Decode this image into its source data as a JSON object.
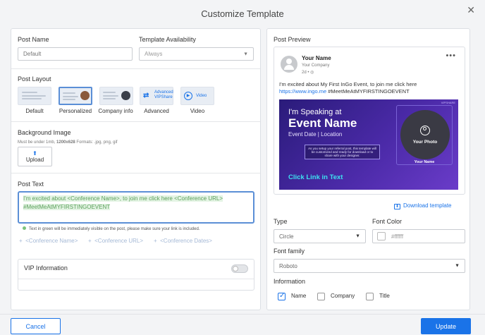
{
  "dialog": {
    "title": "Customize Template"
  },
  "post_name": {
    "label": "Post Name",
    "placeholder": "Default"
  },
  "template_availability": {
    "label": "Template Availability",
    "value": "Always"
  },
  "post_layout": {
    "label": "Post Layout",
    "options": [
      {
        "label": "Default"
      },
      {
        "label": "Personalized"
      },
      {
        "label": "Company info"
      },
      {
        "label": "Advanced",
        "inner": "Advanced VIPShare"
      },
      {
        "label": "Video",
        "inner": "Video"
      }
    ]
  },
  "background_image": {
    "label": "Background Image",
    "hint_prefix": "Must be under 1mb,",
    "hint_size": "1200x628",
    "hint_suffix": "Formats: .jpg, png, gif",
    "upload_label": "Upload"
  },
  "post_text": {
    "label": "Post Text",
    "value": "I'm excited about <Conference Name>, to join me click here <Conference URL> #MeetMeAtMYFIRSTINGOEVENT",
    "hint": "Text in green will be immediately visible on the post, please make sure your link is included.",
    "chips": [
      "<Conference Name>",
      "<Conference URL>",
      "<Conference Dates>"
    ]
  },
  "vip_information": {
    "label": "VIP Information"
  },
  "preview": {
    "label": "Post Preview",
    "name": "Your Name",
    "company": "Your Company",
    "time": "2d •",
    "text_line1": "I'm excited about My First InGo Event, to join me click here",
    "link": "https://www.ingo.me",
    "hashtag": "#MeetMeAtMYFIRSTINGOEVENT",
    "banner": {
      "speaking": "I'm Speaking at",
      "event_name": "Event Name",
      "event_meta": "Event Date | Location",
      "description": "As you setup your referral post, this template will be customized and ready for download or to share with your designer.",
      "cta": "Click Link in Text",
      "photo_label": "Your Photo",
      "name_label": "Your Name",
      "brand": "VIPSHARE"
    },
    "download_label": "Download template"
  },
  "type": {
    "label": "Type",
    "value": "Circle"
  },
  "font_color": {
    "label": "Font Color",
    "value": "#ffffff"
  },
  "font_family": {
    "label": "Font family",
    "value": "Roboto"
  },
  "information": {
    "label": "Information",
    "options": [
      {
        "label": "Name",
        "checked": true
      },
      {
        "label": "Company",
        "checked": false
      },
      {
        "label": "Title",
        "checked": false
      }
    ]
  },
  "footer": {
    "cancel_label": "Cancel",
    "update_label": "Update"
  },
  "colors": {
    "primary": "#1a73e8",
    "banner_bg": "#3b1a8a",
    "accent_cyan": "#3de0f0"
  }
}
